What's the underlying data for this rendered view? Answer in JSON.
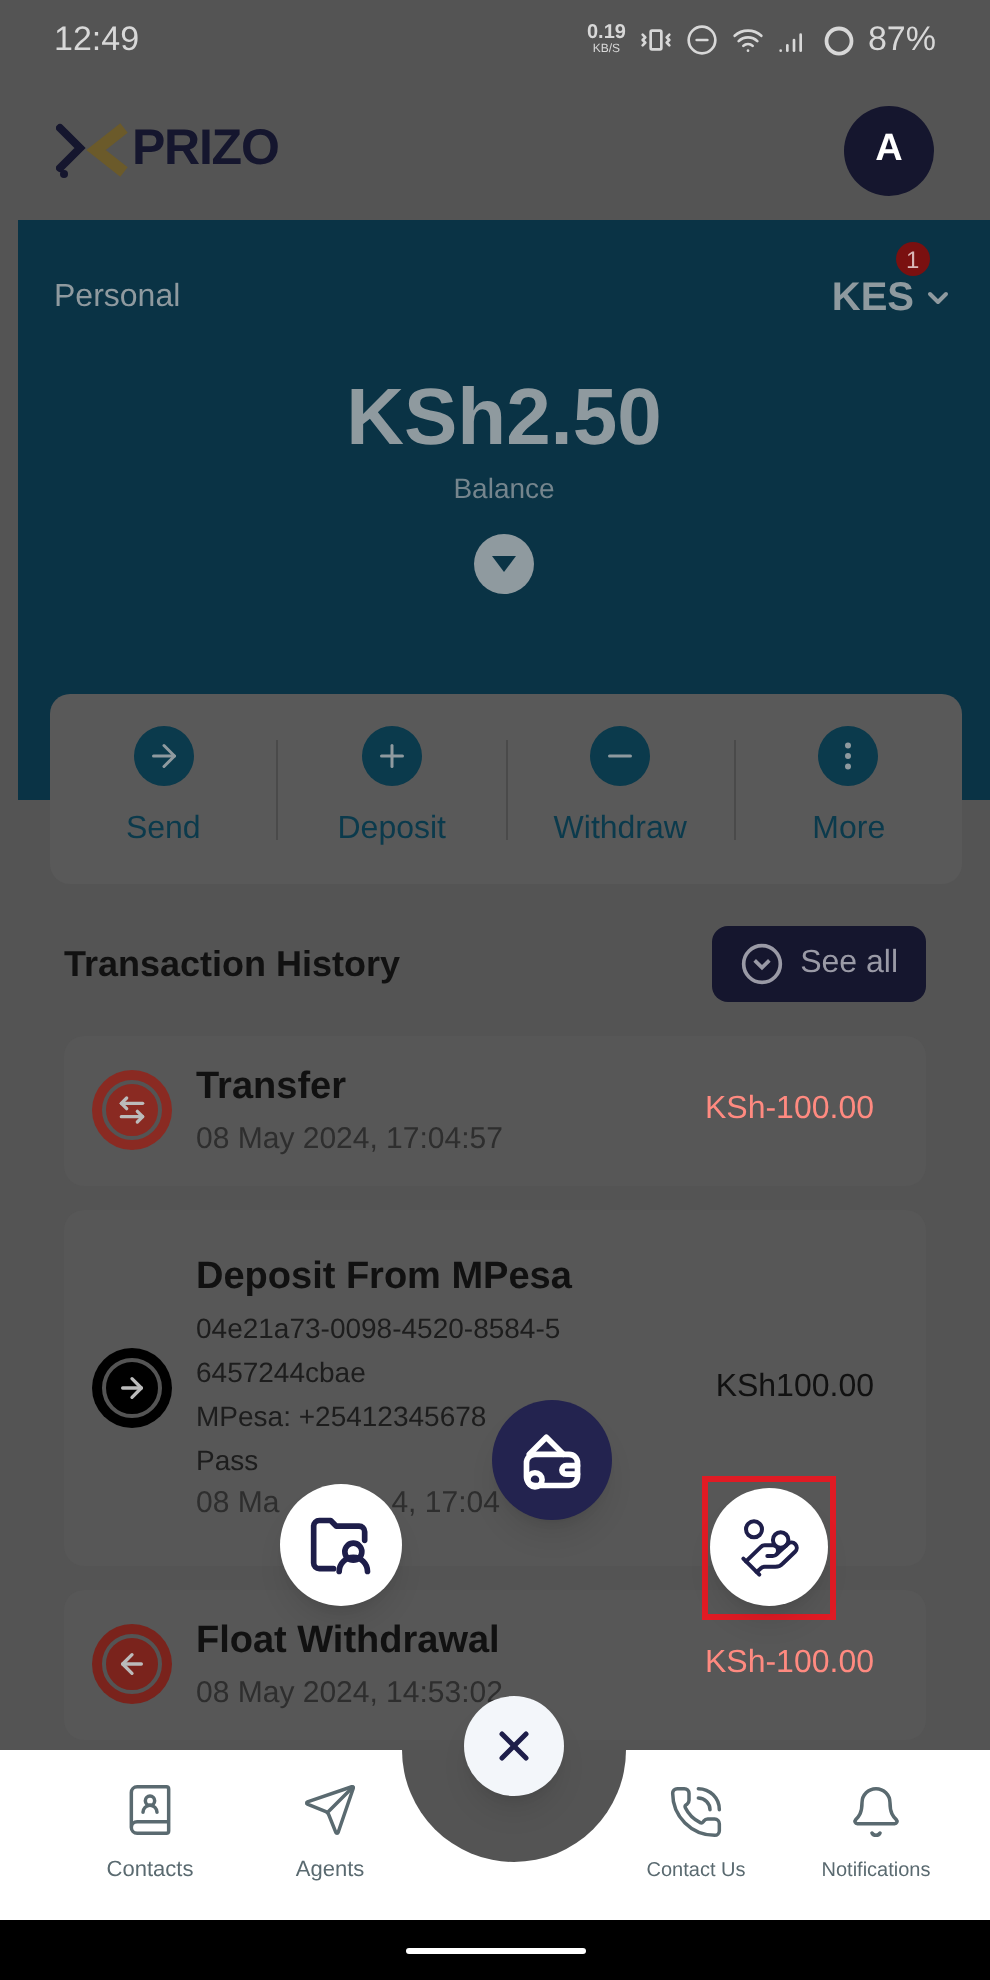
{
  "status_bar": {
    "time": "12:49",
    "speed": "0.19",
    "speed_unit": "KB/S",
    "battery": "87%"
  },
  "header": {
    "logo_text": "PRIZO",
    "avatar": "A"
  },
  "balance_card": {
    "account": "Personal",
    "currency": "KES",
    "currency_badge": "1",
    "amount": "KSh2.50",
    "label": "Balance"
  },
  "actions": [
    {
      "kind": "send",
      "label": "Send"
    },
    {
      "kind": "deposit",
      "label": "Deposit"
    },
    {
      "kind": "withdraw",
      "label": "Withdraw"
    },
    {
      "kind": "more",
      "label": "More"
    }
  ],
  "transactions": {
    "title": "Transaction History",
    "see_all": "See all",
    "items": [
      {
        "kind": "transfer",
        "title": "Transfer",
        "date_parts": [
          "08 May 2024, 17:04:57"
        ],
        "amount": "KSh-100.00"
      },
      {
        "kind": "deposit",
        "title": "Deposit From MPesa",
        "lines": [
          "04e21a73-0098-4520-8584-5",
          "6457244cbae",
          "MPesa: +25412345678",
          "Pass"
        ],
        "date_parts": [
          "08 Ma",
          "4, 17:04"
        ],
        "amount": "KSh100.00"
      },
      {
        "kind": "withdrawal",
        "title": "Float Withdrawal",
        "date_parts": [
          "08 May 2024, 14:53:02"
        ],
        "amount": "KSh-100.00"
      }
    ]
  },
  "fab_menu": [
    {
      "kind": "folder",
      "highlighted": false
    },
    {
      "kind": "wallet",
      "highlighted": false
    },
    {
      "kind": "money",
      "highlighted": true
    },
    {
      "kind": "close",
      "highlighted": false
    }
  ],
  "bottom_nav": [
    {
      "kind": "contacts",
      "label": "Contacts"
    },
    {
      "kind": "agents",
      "label": "Agents"
    },
    {
      "kind": "contact",
      "label": "Contact Us"
    },
    {
      "kind": "notifications",
      "label": "Notifications"
    }
  ]
}
